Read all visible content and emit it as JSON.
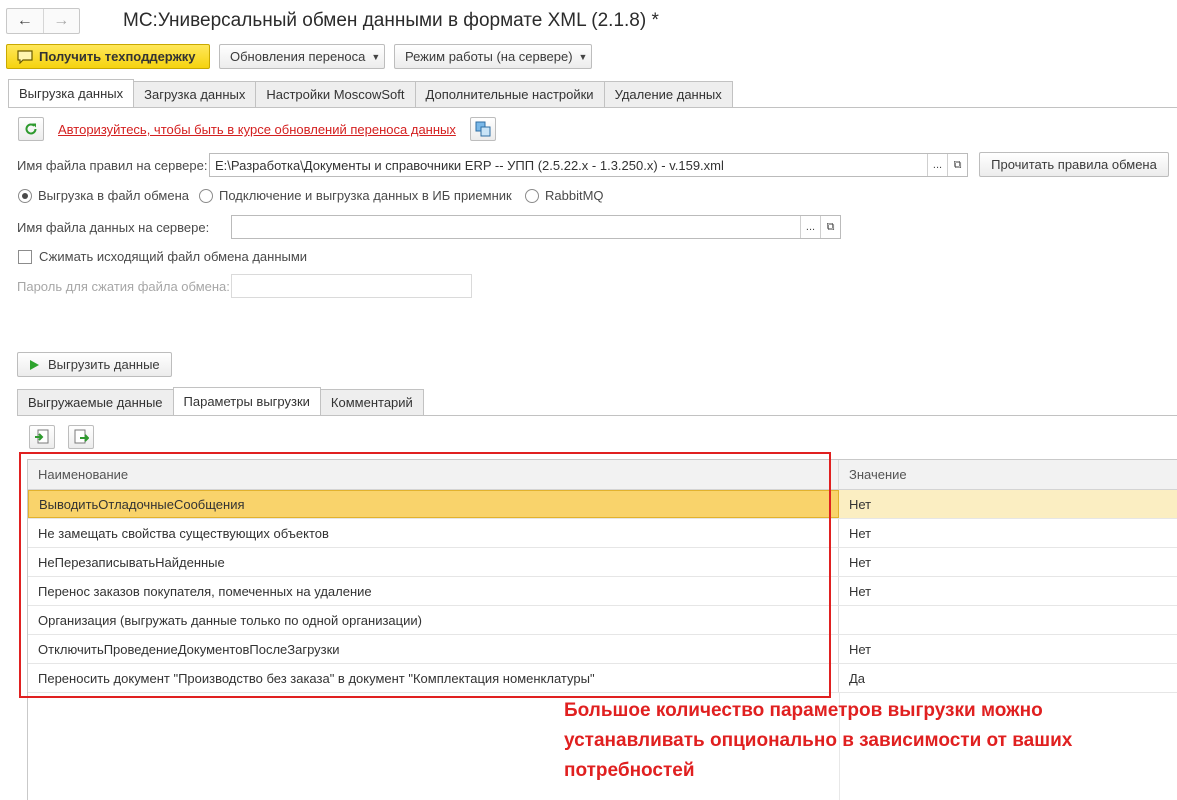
{
  "window": {
    "title": "МС:Универсальный обмен данными в формате XML (2.1.8) *",
    "nav_back": "←",
    "nav_forward": "→"
  },
  "toolbar": {
    "support_label": "Получить техподдержку",
    "updates_label": "Обновления переноса",
    "mode_label": "Режим работы (на сервере)"
  },
  "main_tabs": [
    {
      "label": "Выгрузка данных",
      "active": true
    },
    {
      "label": "Загрузка данных",
      "active": false
    },
    {
      "label": "Настройки MoscowSoft",
      "active": false
    },
    {
      "label": "Дополнительные настройки",
      "active": false
    },
    {
      "label": "Удаление данных",
      "active": false
    }
  ],
  "auth": {
    "link_text": "Авторизуйтесь, чтобы быть в курсе обновлений переноса данных"
  },
  "rules_file": {
    "label": "Имя файла правил на сервере:",
    "value": "E:\\Разработка\\Документы и справочники ERP -- УПП (2.5.22.x - 1.3.250.x) - v.159.xml",
    "read_button": "Прочитать правила обмена"
  },
  "export_mode": {
    "options": [
      {
        "label": "Выгрузка в файл обмена",
        "selected": true
      },
      {
        "label": "Подключение и выгрузка данных в ИБ приемник",
        "selected": false
      },
      {
        "label": "RabbitMQ",
        "selected": false
      }
    ]
  },
  "data_file": {
    "label": "Имя файла данных на сервере:",
    "value": ""
  },
  "compress": {
    "label": "Сжимать исходящий файл обмена данными",
    "checked": false
  },
  "password": {
    "label": "Пароль для сжатия файла обмена:",
    "value": ""
  },
  "export_button": {
    "label": "Выгрузить данные"
  },
  "sub_tabs": [
    {
      "label": "Выгружаемые данные",
      "active": false
    },
    {
      "label": "Параметры выгрузки",
      "active": true
    },
    {
      "label": "Комментарий",
      "active": false
    }
  ],
  "params_table": {
    "columns": [
      "Наименование",
      "Значение"
    ],
    "rows": [
      {
        "name": "ВыводитьОтладочныеСообщения",
        "value": "Нет",
        "selected": true
      },
      {
        "name": "Не замещать свойства существующих объектов",
        "value": "Нет",
        "selected": false
      },
      {
        "name": "НеПерезаписыватьНайденные",
        "value": "Нет",
        "selected": false
      },
      {
        "name": "Перенос заказов покупателя, помеченных на удаление",
        "value": "Нет",
        "selected": false
      },
      {
        "name": "Организация (выгружать данные только по одной организации)",
        "value": "",
        "selected": false
      },
      {
        "name": "ОтключитьПроведениеДокументовПослеЗагрузки",
        "value": "Нет",
        "selected": false
      },
      {
        "name": "Переносить документ \"Производство без заказа\" в документ \"Комплектация номенклатуры\"",
        "value": "Да",
        "selected": false
      }
    ]
  },
  "annotation": {
    "lines": [
      "Большое количество параметров выгрузки можно",
      "устанавливать опционально в зависимости от ваших",
      "потребностей"
    ]
  },
  "colors": {
    "accent_yellow": "#f5d30f",
    "selection": "#f9d36b",
    "annotation_red": "#e02020",
    "link_red": "#d42020"
  }
}
